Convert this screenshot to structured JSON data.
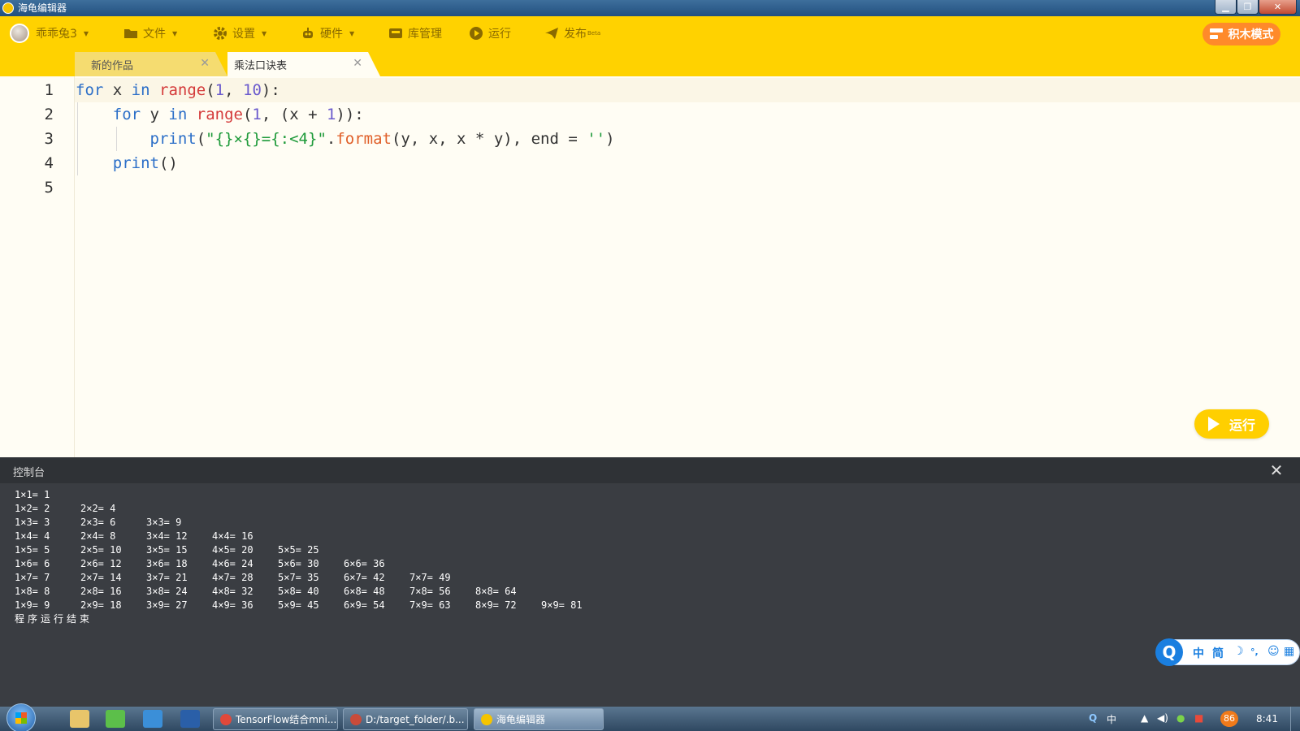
{
  "window": {
    "title": "海龟编辑器",
    "min_label": "▁",
    "max_label": "❐",
    "close_label": "✕"
  },
  "toolbar": {
    "user": "乖乖兔3",
    "file": "文件",
    "settings": "设置",
    "hardware": "硬件",
    "library": "库管理",
    "run": "运行",
    "publish": "发布",
    "publish_beta": "Beta",
    "blocks_mode": "积木模式",
    "accent_color": "#ffd200"
  },
  "tabs": [
    {
      "label": "新的作品",
      "close": "✕"
    },
    {
      "label": "乘法口诀表",
      "close": "✕"
    }
  ],
  "editor": {
    "line_numbers": [
      "1",
      "2",
      "3",
      "4",
      "5"
    ],
    "line1": {
      "t1": "for",
      "t2": " x ",
      "t3": "in",
      "t4": " ",
      "t5": "range",
      "t6": "(",
      "t7": "1",
      "t8": ", ",
      "t9": "10",
      "t10": "):"
    },
    "line2": {
      "t0": "    ",
      "t1": "for",
      "t2": " y ",
      "t3": "in",
      "t4": " ",
      "t5": "range",
      "t6": "(",
      "t7": "1",
      "t8": ", (x + ",
      "t9": "1",
      "t10": ")):"
    },
    "line3": {
      "t0": "        ",
      "t1": "print",
      "t2": "(",
      "t3": "\"{}×{}={:<4}\"",
      "t4": ".",
      "t5": "format",
      "t6": "(y, x, x * y), end = ",
      "t7": "''",
      "t8": ")"
    },
    "line4": {
      "t0": "    ",
      "t1": "print",
      "t2": "()"
    },
    "run_button": "运行"
  },
  "console": {
    "title": "控制台",
    "close": "✕",
    "rows": [
      [
        "1×1= 1"
      ],
      [
        "1×2= 2",
        "2×2= 4"
      ],
      [
        "1×3= 3",
        "2×3= 6",
        "3×3= 9"
      ],
      [
        "1×4= 4",
        "2×4= 8",
        "3×4= 12",
        "4×4= 16"
      ],
      [
        "1×5= 5",
        "2×5= 10",
        "3×5= 15",
        "4×5= 20",
        "5×5= 25"
      ],
      [
        "1×6= 6",
        "2×6= 12",
        "3×6= 18",
        "4×6= 24",
        "5×6= 30",
        "6×6= 36"
      ],
      [
        "1×7= 7",
        "2×7= 14",
        "3×7= 21",
        "4×7= 28",
        "5×7= 35",
        "6×7= 42",
        "7×7= 49"
      ],
      [
        "1×8= 8",
        "2×8= 16",
        "3×8= 24",
        "4×8= 32",
        "5×8= 40",
        "6×8= 48",
        "7×8= 56",
        "8×8= 64"
      ],
      [
        "1×9= 9",
        "2×9= 18",
        "3×9= 27",
        "4×9= 36",
        "5×9= 45",
        "6×9= 54",
        "7×9= 63",
        "8×9= 72",
        "9×9= 81"
      ]
    ],
    "end_message": "程序运行结束"
  },
  "ime": {
    "logo": "Q",
    "lang": "中",
    "mode": "简",
    "moon": "☽",
    "punct": "°,",
    "emoji": "☺",
    "grid": "▦"
  },
  "taskbar": {
    "tasks": [
      "TensorFlow结合mni...",
      "D:/target_folder/.b...",
      "海龟编辑器"
    ],
    "tray_lang": "中",
    "badge": "86",
    "clock": "8:41"
  }
}
